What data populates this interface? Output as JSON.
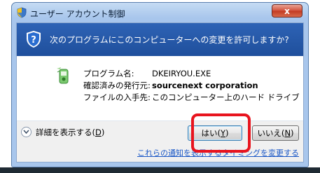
{
  "window": {
    "title": "ユーザー アカウント制御",
    "close_label": "x"
  },
  "header": {
    "message": "次のプログラムにこのコンピューターへの変更を許可しますか?"
  },
  "details": {
    "program_label": "プログラム名:",
    "program_value": "DKEIRYOU.EXE",
    "publisher_label": "確認済みの発行元:",
    "publisher_value": "sourcenext corporation",
    "origin_label": "ファイルの入手先:",
    "origin_value": "このコンピューター上のハード ドライブ"
  },
  "footer": {
    "show_details_text": "詳細を表示する(",
    "show_details_key": "D",
    "show_details_close": ")",
    "yes_text": "はい(",
    "yes_key": "Y",
    "yes_close": ")",
    "no_text": "いいえ(",
    "no_key": "N",
    "no_close": ")",
    "notification_link": "これらの通知を表示するタイミングを変更する"
  },
  "colors": {
    "highlight": "#e8141e",
    "header_band": "#1f4f9c",
    "link": "#1a57c6"
  }
}
